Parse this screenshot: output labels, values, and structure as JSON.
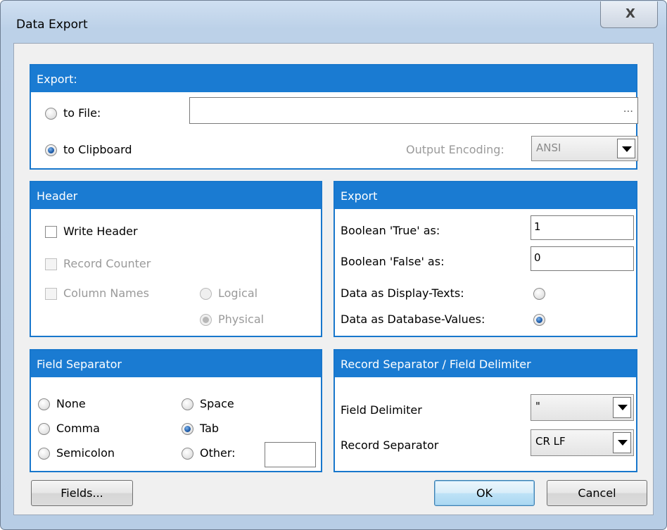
{
  "window": {
    "title": "Data Export",
    "close_glyph": "X"
  },
  "export_target": {
    "header": "Export:",
    "to_file_label": "to File:",
    "file_value": "",
    "browse_glyph": "...",
    "to_clipboard_label": "to Clipboard",
    "output_encoding_label": "Output Encoding:",
    "output_encoding_value": "ANSI",
    "selected": "to Clipboard"
  },
  "header_panel": {
    "header": "Header",
    "write_header_label": "Write Header",
    "write_header_checked": false,
    "record_counter_label": "Record Counter",
    "column_names_label": "Column Names",
    "logical_label": "Logical",
    "physical_label": "Physical",
    "name_mode_selected": "Physical"
  },
  "export_panel": {
    "header": "Export",
    "bool_true_label": "Boolean 'True' as:",
    "bool_true_value": "1",
    "bool_false_label": "Boolean 'False' as:",
    "bool_false_value": "0",
    "display_texts_label": "Data as Display-Texts:",
    "db_values_label": "Data as Database-Values:",
    "data_mode_selected": "Data as Database-Values:"
  },
  "field_separator": {
    "header": "Field Separator",
    "none_label": "None",
    "comma_label": "Comma",
    "semicolon_label": "Semicolon",
    "space_label": "Space",
    "tab_label": "Tab",
    "other_label": "Other:",
    "other_value": "",
    "selected": "Tab"
  },
  "record_separator": {
    "header": "Record Separator / Field Delimiter",
    "field_delimiter_label": "Field Delimiter",
    "field_delimiter_value": "\"",
    "record_separator_label": "Record Separator",
    "record_separator_value": "CR LF"
  },
  "buttons": {
    "fields": "Fields...",
    "ok": "OK",
    "cancel": "Cancel"
  }
}
